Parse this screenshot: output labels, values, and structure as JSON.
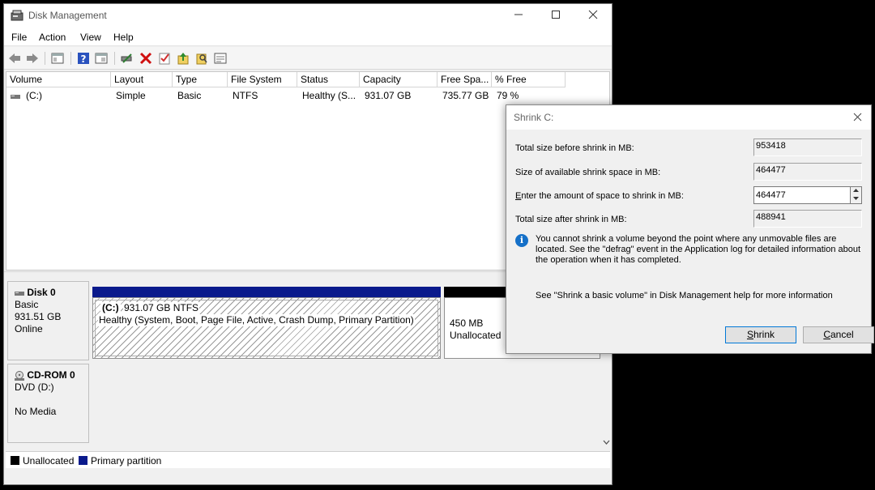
{
  "window": {
    "title": "Disk Management"
  },
  "menu": [
    "File",
    "Action",
    "View",
    "Help"
  ],
  "toolbar_icons": [
    "back-icon",
    "forward-icon",
    "properties-icon",
    "help-icon",
    "show-hide-icon",
    "connect-icon",
    "delete-icon",
    "check-icon",
    "import-icon",
    "rescan-icon",
    "console-icon"
  ],
  "volume_list": {
    "columns": [
      "Volume",
      "Layout",
      "Type",
      "File System",
      "Status",
      "Capacity",
      "Free Spa...",
      "% Free"
    ],
    "rows": [
      [
        "(C:)",
        "Simple",
        "Basic",
        "NTFS",
        "Healthy (S...",
        "931.07 GB",
        "735.77 GB",
        "79 %"
      ]
    ]
  },
  "disks": [
    {
      "name": "Disk 0",
      "type": "Basic",
      "size": "931.51 GB",
      "status": "Online",
      "partitions": [
        {
          "name": "(C:)",
          "size": "931.07 GB NTFS",
          "detail": "Healthy (System, Boot, Page File, Active, Crash Dump, Primary Partition)"
        },
        {
          "name": "",
          "size": "450 MB",
          "detail": "Unallocated"
        }
      ]
    },
    {
      "name": "CD-ROM 0",
      "type": "DVD (D:)",
      "size": "",
      "status": "No Media"
    }
  ],
  "legend": [
    {
      "label": "Unallocated",
      "color": "#000000"
    },
    {
      "label": "Primary partition",
      "color": "#0a1a8c"
    }
  ],
  "dialog": {
    "title": "Shrink C:",
    "total_before_label": "Total size before shrink in MB:",
    "total_before_value": "953418",
    "available_label": "Size of available shrink space in MB:",
    "available_value": "464477",
    "amount_label_prefix": "E",
    "amount_label_rest": "nter the amount of space to shrink in MB:",
    "amount_value": "464477",
    "total_after_label": "Total size after shrink in MB:",
    "total_after_value": "488941",
    "info": "You cannot shrink a volume beyond the point where any unmovable files are located. See the \"defrag\" event in the Application log for detailed information about the operation when it has completed.",
    "help": "See \"Shrink a basic volume\" in Disk Management help for more information",
    "shrink_prefix": "S",
    "shrink_rest": "hrink",
    "cancel_prefix": "C",
    "cancel_rest": "ancel"
  }
}
